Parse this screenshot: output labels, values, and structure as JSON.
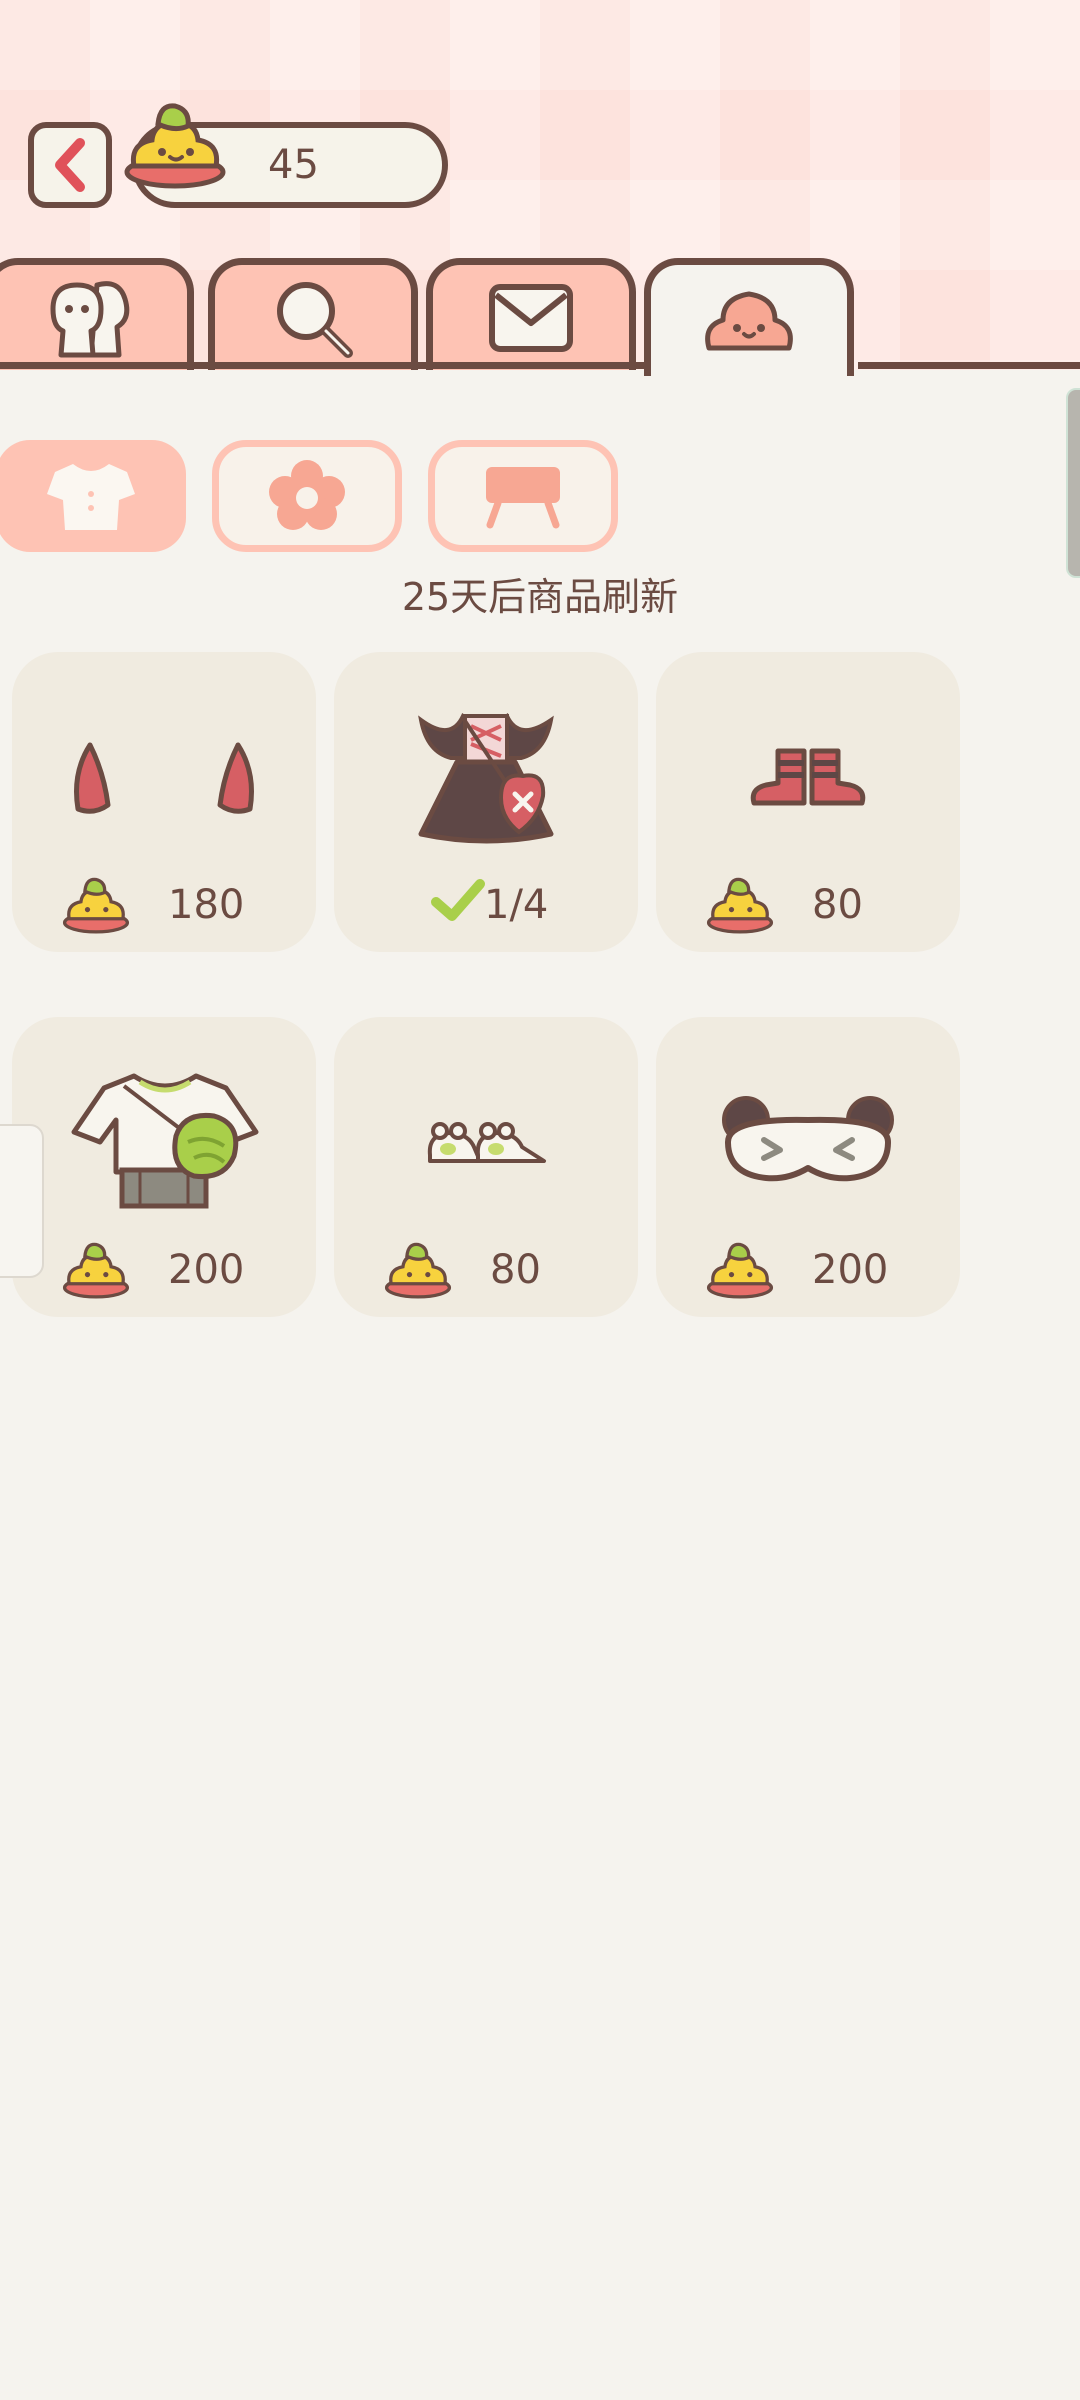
{
  "header": {
    "coin_count": "45"
  },
  "tabs": [
    {
      "icon": "friends-icon",
      "active": false
    },
    {
      "icon": "search-icon",
      "active": false
    },
    {
      "icon": "mail-icon",
      "active": false
    },
    {
      "icon": "poop-shop-icon",
      "active": true
    }
  ],
  "categories": [
    {
      "icon": "shirt-icon",
      "active": true
    },
    {
      "icon": "flower-icon",
      "active": false
    },
    {
      "icon": "furniture-icon",
      "active": false
    }
  ],
  "shop": {
    "refresh_text": "25天后商品刷新",
    "items": [
      {
        "icon": "devil-horns-icon",
        "price": "180",
        "currency_icon": "poop-coin-icon"
      },
      {
        "icon": "bat-dress-icon",
        "progress": "1/4",
        "owned_icon": "check-icon"
      },
      {
        "icon": "striped-socks-icon",
        "price": "80",
        "currency_icon": "poop-coin-icon"
      },
      {
        "icon": "cabbage-outfit-icon",
        "price": "200",
        "currency_icon": "poop-coin-icon"
      },
      {
        "icon": "frog-slippers-icon",
        "price": "80",
        "currency_icon": "poop-coin-icon"
      },
      {
        "icon": "panda-sleep-mask-icon",
        "price": "200",
        "currency_icon": "poop-coin-icon"
      }
    ]
  },
  "colors": {
    "outline": "#6b4b42",
    "accent_pink": "#fec3b4",
    "background": "#f5f3ee",
    "card": "#f0ebe0"
  }
}
